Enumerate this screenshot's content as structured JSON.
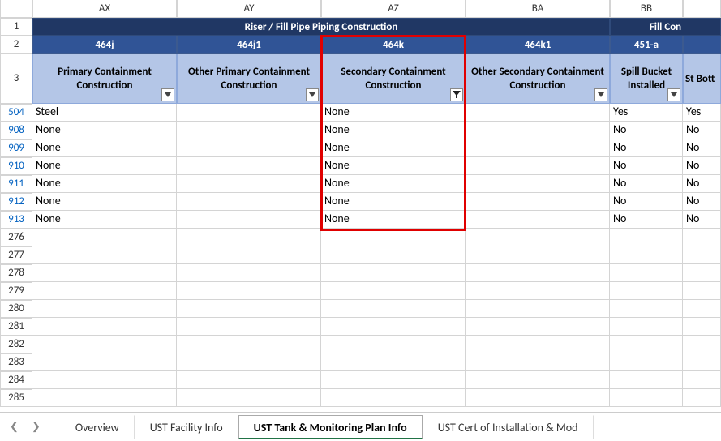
{
  "columns": [
    "AX",
    "AY",
    "AZ",
    "BA",
    "BB"
  ],
  "header_rows": [
    "1",
    "2",
    "3"
  ],
  "section": {
    "left": "Riser / Fill Pipe Piping Construction",
    "right": "Fill Con"
  },
  "codes": {
    "ax": "464j",
    "ay": "464j1",
    "az": "464k",
    "ba": "464k1",
    "bb": "451-a",
    "bc": ""
  },
  "fields": {
    "ax": "Primary Containment Construction",
    "ay": "Other Primary Containment Construction",
    "az": "Secondary Containment Construction",
    "ba": "Other Secondary Containment Construction",
    "bb": "Spill Bucket Installed",
    "bc": "St Bott"
  },
  "rows": [
    {
      "n": "504",
      "ax": "Steel",
      "ay": "",
      "az": "None",
      "ba": "",
      "bb": "Yes",
      "bc": "Yes"
    },
    {
      "n": "908",
      "ax": "None",
      "ay": "",
      "az": "None",
      "ba": "",
      "bb": "No",
      "bc": "No"
    },
    {
      "n": "909",
      "ax": "None",
      "ay": "",
      "az": "None",
      "ba": "",
      "bb": "No",
      "bc": "No"
    },
    {
      "n": "910",
      "ax": "None",
      "ay": "",
      "az": "None",
      "ba": "",
      "bb": "No",
      "bc": "No"
    },
    {
      "n": "911",
      "ax": "None",
      "ay": "",
      "az": "None",
      "ba": "",
      "bb": "No",
      "bc": "No"
    },
    {
      "n": "912",
      "ax": "None",
      "ay": "",
      "az": "None",
      "ba": "",
      "bb": "No",
      "bc": "No"
    },
    {
      "n": "913",
      "ax": "None",
      "ay": "",
      "az": "None",
      "ba": "",
      "bb": "No",
      "bc": "No"
    }
  ],
  "empty_rows": [
    "276",
    "277",
    "278",
    "279",
    "280",
    "281",
    "282",
    "283",
    "284",
    "285"
  ],
  "tabs": {
    "overview": "Overview",
    "facility": "UST Facility Info",
    "monitoring": "UST Tank & Monitoring Plan Info",
    "cert": "UST Cert of Installation & Mod"
  }
}
